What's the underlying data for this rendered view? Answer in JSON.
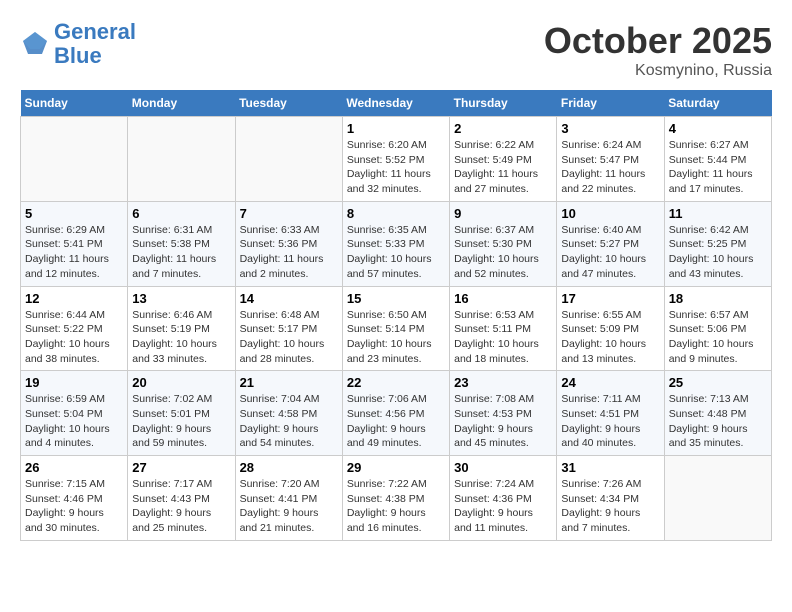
{
  "header": {
    "logo_line1": "General",
    "logo_line2": "Blue",
    "month": "October 2025",
    "location": "Kosmynino, Russia"
  },
  "weekdays": [
    "Sunday",
    "Monday",
    "Tuesday",
    "Wednesday",
    "Thursday",
    "Friday",
    "Saturday"
  ],
  "weeks": [
    [
      {
        "day": "",
        "info": ""
      },
      {
        "day": "",
        "info": ""
      },
      {
        "day": "",
        "info": ""
      },
      {
        "day": "1",
        "info": "Sunrise: 6:20 AM\nSunset: 5:52 PM\nDaylight: 11 hours\nand 32 minutes."
      },
      {
        "day": "2",
        "info": "Sunrise: 6:22 AM\nSunset: 5:49 PM\nDaylight: 11 hours\nand 27 minutes."
      },
      {
        "day": "3",
        "info": "Sunrise: 6:24 AM\nSunset: 5:47 PM\nDaylight: 11 hours\nand 22 minutes."
      },
      {
        "day": "4",
        "info": "Sunrise: 6:27 AM\nSunset: 5:44 PM\nDaylight: 11 hours\nand 17 minutes."
      }
    ],
    [
      {
        "day": "5",
        "info": "Sunrise: 6:29 AM\nSunset: 5:41 PM\nDaylight: 11 hours\nand 12 minutes."
      },
      {
        "day": "6",
        "info": "Sunrise: 6:31 AM\nSunset: 5:38 PM\nDaylight: 11 hours\nand 7 minutes."
      },
      {
        "day": "7",
        "info": "Sunrise: 6:33 AM\nSunset: 5:36 PM\nDaylight: 11 hours\nand 2 minutes."
      },
      {
        "day": "8",
        "info": "Sunrise: 6:35 AM\nSunset: 5:33 PM\nDaylight: 10 hours\nand 57 minutes."
      },
      {
        "day": "9",
        "info": "Sunrise: 6:37 AM\nSunset: 5:30 PM\nDaylight: 10 hours\nand 52 minutes."
      },
      {
        "day": "10",
        "info": "Sunrise: 6:40 AM\nSunset: 5:27 PM\nDaylight: 10 hours\nand 47 minutes."
      },
      {
        "day": "11",
        "info": "Sunrise: 6:42 AM\nSunset: 5:25 PM\nDaylight: 10 hours\nand 43 minutes."
      }
    ],
    [
      {
        "day": "12",
        "info": "Sunrise: 6:44 AM\nSunset: 5:22 PM\nDaylight: 10 hours\nand 38 minutes."
      },
      {
        "day": "13",
        "info": "Sunrise: 6:46 AM\nSunset: 5:19 PM\nDaylight: 10 hours\nand 33 minutes."
      },
      {
        "day": "14",
        "info": "Sunrise: 6:48 AM\nSunset: 5:17 PM\nDaylight: 10 hours\nand 28 minutes."
      },
      {
        "day": "15",
        "info": "Sunrise: 6:50 AM\nSunset: 5:14 PM\nDaylight: 10 hours\nand 23 minutes."
      },
      {
        "day": "16",
        "info": "Sunrise: 6:53 AM\nSunset: 5:11 PM\nDaylight: 10 hours\nand 18 minutes."
      },
      {
        "day": "17",
        "info": "Sunrise: 6:55 AM\nSunset: 5:09 PM\nDaylight: 10 hours\nand 13 minutes."
      },
      {
        "day": "18",
        "info": "Sunrise: 6:57 AM\nSunset: 5:06 PM\nDaylight: 10 hours\nand 9 minutes."
      }
    ],
    [
      {
        "day": "19",
        "info": "Sunrise: 6:59 AM\nSunset: 5:04 PM\nDaylight: 10 hours\nand 4 minutes."
      },
      {
        "day": "20",
        "info": "Sunrise: 7:02 AM\nSunset: 5:01 PM\nDaylight: 9 hours\nand 59 minutes."
      },
      {
        "day": "21",
        "info": "Sunrise: 7:04 AM\nSunset: 4:58 PM\nDaylight: 9 hours\nand 54 minutes."
      },
      {
        "day": "22",
        "info": "Sunrise: 7:06 AM\nSunset: 4:56 PM\nDaylight: 9 hours\nand 49 minutes."
      },
      {
        "day": "23",
        "info": "Sunrise: 7:08 AM\nSunset: 4:53 PM\nDaylight: 9 hours\nand 45 minutes."
      },
      {
        "day": "24",
        "info": "Sunrise: 7:11 AM\nSunset: 4:51 PM\nDaylight: 9 hours\nand 40 minutes."
      },
      {
        "day": "25",
        "info": "Sunrise: 7:13 AM\nSunset: 4:48 PM\nDaylight: 9 hours\nand 35 minutes."
      }
    ],
    [
      {
        "day": "26",
        "info": "Sunrise: 7:15 AM\nSunset: 4:46 PM\nDaylight: 9 hours\nand 30 minutes."
      },
      {
        "day": "27",
        "info": "Sunrise: 7:17 AM\nSunset: 4:43 PM\nDaylight: 9 hours\nand 25 minutes."
      },
      {
        "day": "28",
        "info": "Sunrise: 7:20 AM\nSunset: 4:41 PM\nDaylight: 9 hours\nand 21 minutes."
      },
      {
        "day": "29",
        "info": "Sunrise: 7:22 AM\nSunset: 4:38 PM\nDaylight: 9 hours\nand 16 minutes."
      },
      {
        "day": "30",
        "info": "Sunrise: 7:24 AM\nSunset: 4:36 PM\nDaylight: 9 hours\nand 11 minutes."
      },
      {
        "day": "31",
        "info": "Sunrise: 7:26 AM\nSunset: 4:34 PM\nDaylight: 9 hours\nand 7 minutes."
      },
      {
        "day": "",
        "info": ""
      }
    ]
  ]
}
